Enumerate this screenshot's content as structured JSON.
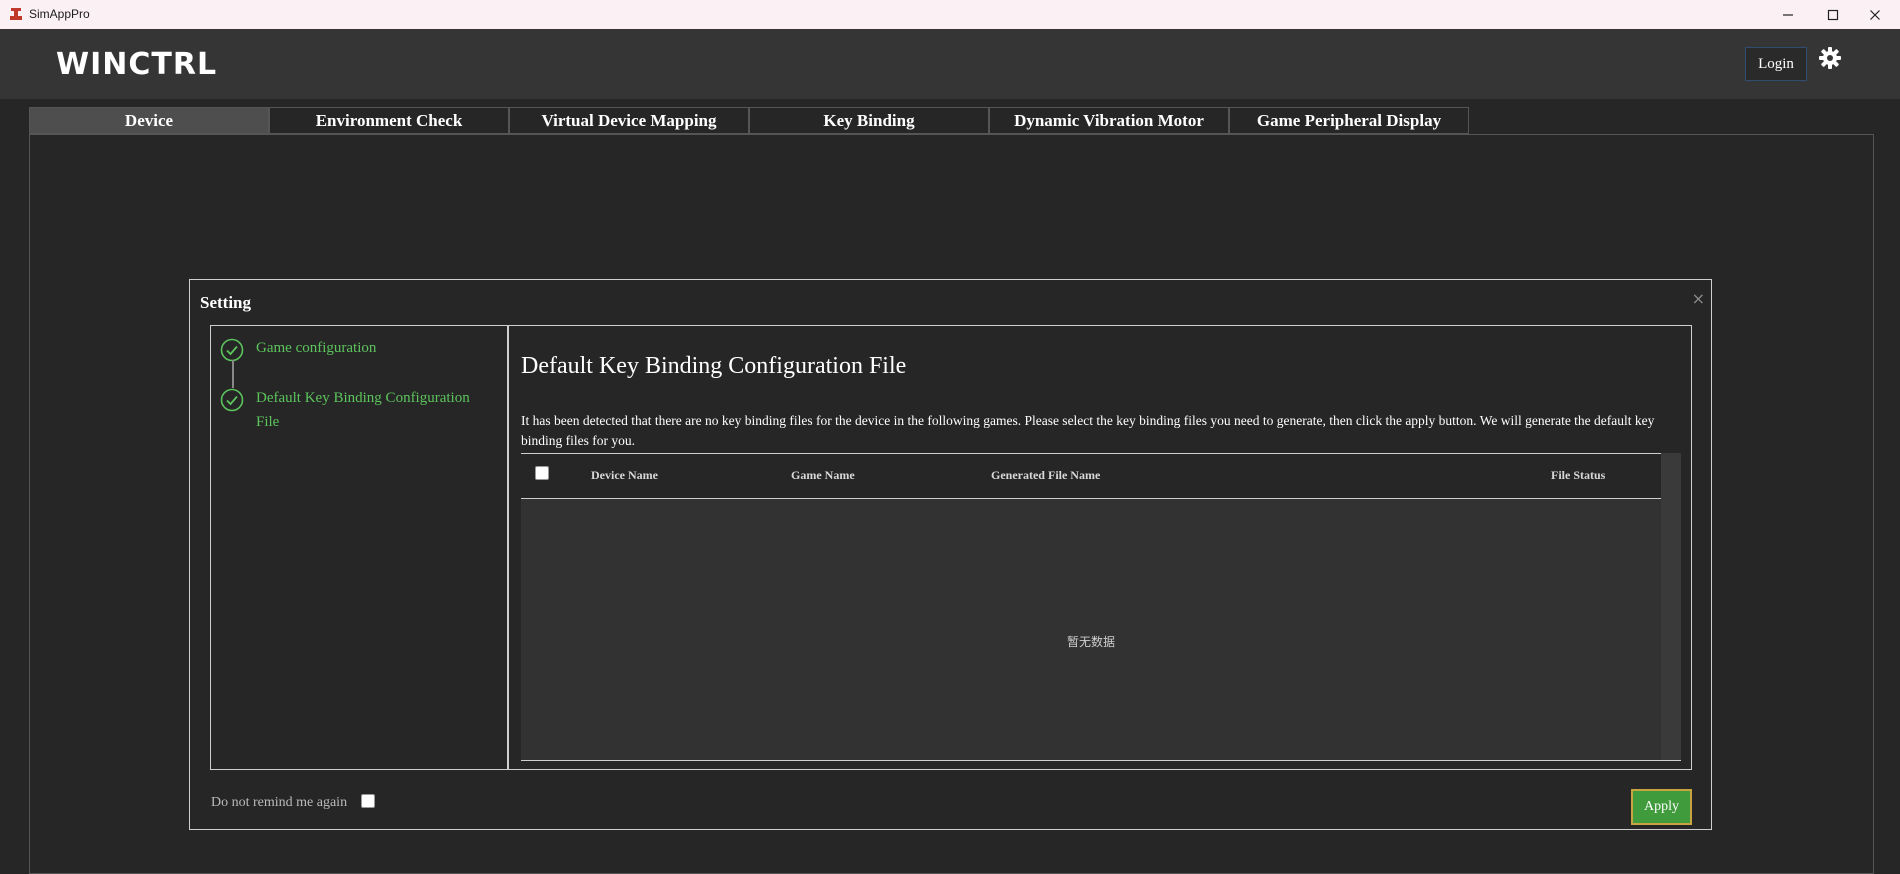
{
  "window": {
    "title": "SimAppPro",
    "minimize_icon": "minimize-icon",
    "maximize_icon": "maximize-icon",
    "close_icon": "close-icon"
  },
  "header": {
    "logo_text": "WINCTRL",
    "login_label": "Login",
    "settings_icon": "gear-icon"
  },
  "tabs": [
    {
      "label": "Device",
      "active": true
    },
    {
      "label": "Environment Check",
      "active": false
    },
    {
      "label": "Virtual Device Mapping",
      "active": false
    },
    {
      "label": "Key Binding",
      "active": false
    },
    {
      "label": "Dynamic Vibration Motor",
      "active": false
    },
    {
      "label": "Game Peripheral Display",
      "active": false
    }
  ],
  "dialog": {
    "title": "Setting",
    "close_symbol": "×",
    "steps": [
      {
        "label": "Game configuration",
        "status": "done"
      },
      {
        "label": "Default Key Binding Configuration File",
        "status": "done"
      }
    ],
    "heading": "Default Key Binding Configuration File",
    "description": "It has been detected that there are no key binding files for the device in the following games. Please select the key binding files you need to generate, then click the apply button. We will generate the default key binding files for you.",
    "table": {
      "columns": [
        "Device Name",
        "Game Name",
        "Generated File Name",
        "File Status"
      ],
      "rows": [],
      "empty_text": "暂无数据"
    },
    "remind_label": "Do not remind me again",
    "apply_label": "Apply"
  },
  "colors": {
    "step_green": "#5cc45c",
    "apply_green": "#3f9b3c",
    "apply_border": "#c8a441",
    "active_tab": "#4e4e4e"
  }
}
